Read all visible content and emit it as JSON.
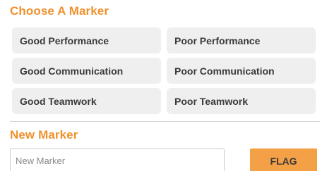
{
  "choose_section": {
    "title": "Choose A Marker",
    "markers": [
      "Good Performance",
      "Poor Performance",
      "Good Communication",
      "Poor Communication",
      "Good Teamwork",
      "Poor Teamwork"
    ]
  },
  "new_section": {
    "title": "New Marker",
    "input_placeholder": "New Marker",
    "input_value": "",
    "flag_label": "FLAG"
  },
  "colors": {
    "accent": "#f0912e",
    "flag_button": "#f4a047",
    "marker_bg": "#efefef",
    "text": "#3a3a3a"
  }
}
